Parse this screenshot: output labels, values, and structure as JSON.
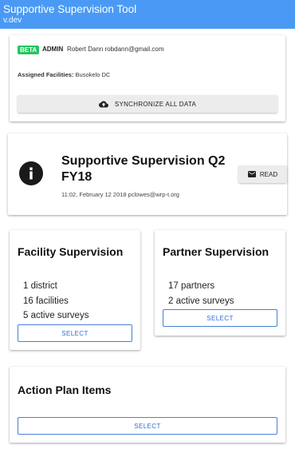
{
  "appbar": {
    "title": "Supportive Supervision Tool",
    "version": "v.dev"
  },
  "user_card": {
    "badge": "BETA",
    "role": "ADMIN",
    "user": "Robert Dann robdann@gmail.com",
    "facilities_label": "Assigned Facilities:",
    "facilities_value": "Busokelo DC",
    "sync_label": "SYNCHRONIZE ALL DATA",
    "sync_icon": "cloud-upload-icon"
  },
  "survey_card": {
    "icon": "info-icon",
    "title": "Supportive Supervision Q2 FY18",
    "meta": "11:02, February 12 2018 pclowes@wrp-t.org",
    "read_label": "READ",
    "read_icon": "mail-icon"
  },
  "facility_card": {
    "title": "Facility Supervision",
    "stats": [
      "1 district",
      "16 facilities",
      "5 active surveys"
    ],
    "select_label": "SELECT"
  },
  "partner_card": {
    "title": "Partner Supervision",
    "stats": [
      "17 partners",
      "2 active surveys"
    ],
    "select_label": "SELECT"
  },
  "action_card": {
    "title": "Action Plan Items",
    "select_label": "SELECT"
  },
  "colors": {
    "appbar": "#4a9af5",
    "beta_badge": "#22c55e",
    "select_text": "#2f6bd6"
  }
}
